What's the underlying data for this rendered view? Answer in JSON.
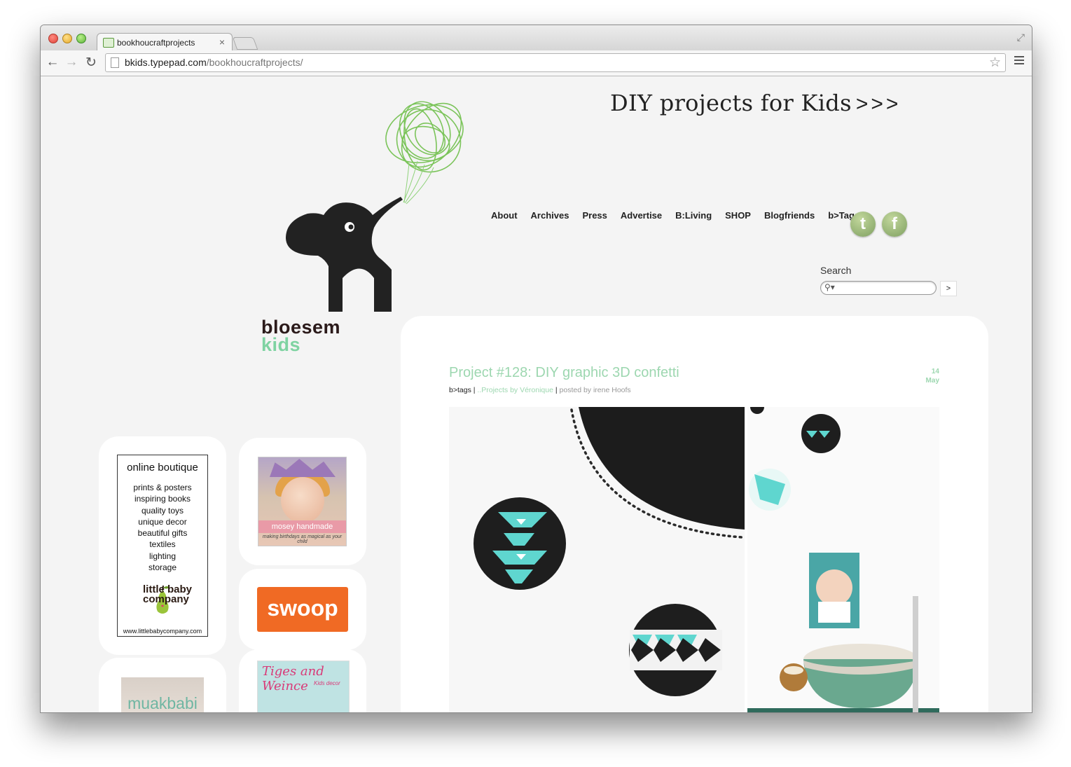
{
  "browser": {
    "tab_title": "bookhoucraftprojects",
    "url_domain": "bkids.typepad.com",
    "url_path": "/bookhoucraftprojects/"
  },
  "header": {
    "headline": "DIY projects for Kids",
    "headline_arrows": ">>>",
    "brand_line1": "bloesem",
    "brand_line2": "kids",
    "brand_color": "#7fd3a2"
  },
  "nav": {
    "items": [
      "About",
      "Archives",
      "Press",
      "Advertise",
      "B:Living",
      "SHOP",
      "Blogfriends",
      "b>Tags"
    ],
    "twitter_glyph": "t",
    "facebook_glyph": "f"
  },
  "search": {
    "label": "Search",
    "placeholder": "",
    "button_label": ">"
  },
  "sidebar": {
    "boutique": {
      "title": "online boutique",
      "items": [
        "prints & posters",
        "inspiring books",
        "quality toys",
        "unique decor",
        "beautiful gifts",
        "textiles",
        "lighting",
        "storage"
      ],
      "brand_line1": "little baby",
      "brand_line2": "company",
      "url": "www.littlebabycompany.com"
    },
    "mosey": {
      "label": "mosey handmade",
      "tagline": "making birthdays as magical as your child"
    },
    "swoop": {
      "label": "swoop"
    },
    "muak": {
      "label": "muakbabi"
    },
    "tiges": {
      "title": "Tiges and Weince",
      "subtitle": "Kids decor"
    }
  },
  "post": {
    "title": "Project #128: DIY graphic 3D confetti",
    "date_day": "14",
    "date_month": "May",
    "meta_tags": "b>tags",
    "meta_sep1": " | ",
    "meta_category": "..Projects by Véronique",
    "meta_sep2": " | ",
    "meta_author": "posted by irene Hoofs",
    "accent_color": "#9dd7b0"
  }
}
